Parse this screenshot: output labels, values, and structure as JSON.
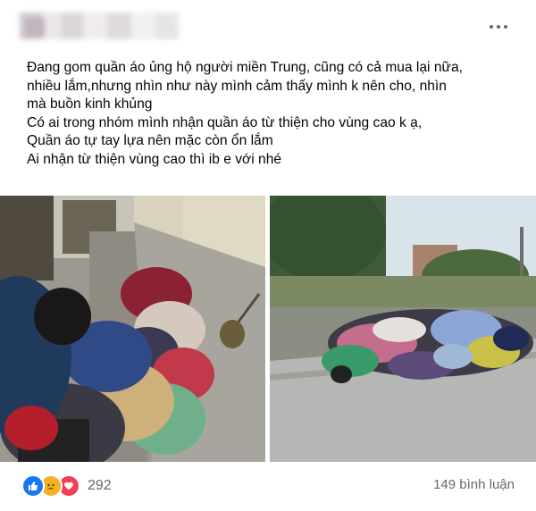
{
  "post": {
    "menu_icon": "more-horizontal-icon",
    "lines": [
      "Đang gom quần áo ủng hộ người miền Trung, cũng có cả mua lại nữa,",
      "nhiều lắm,nhưng nhìn như này mình cảm thấy mình k nên cho, nhìn",
      "mà buồn kinh khủng",
      "Có ai trong nhóm mình nhận quần áo từ thiện cho vùng cao k ạ,",
      "Quần áo tự tay lựa nên mặc còn ổn lắm",
      "Ai nhận từ thiện vùng cao thì ib e với nhé"
    ]
  },
  "footer": {
    "reaction_icons": [
      "like-icon",
      "sad-icon",
      "love-icon"
    ],
    "reaction_count": "292",
    "comment_count": "149 bình luận"
  },
  "colors": {
    "like": "#1877f2",
    "sad": "#f7b125",
    "love": "#f33e58",
    "meta_text": "#65676b"
  }
}
